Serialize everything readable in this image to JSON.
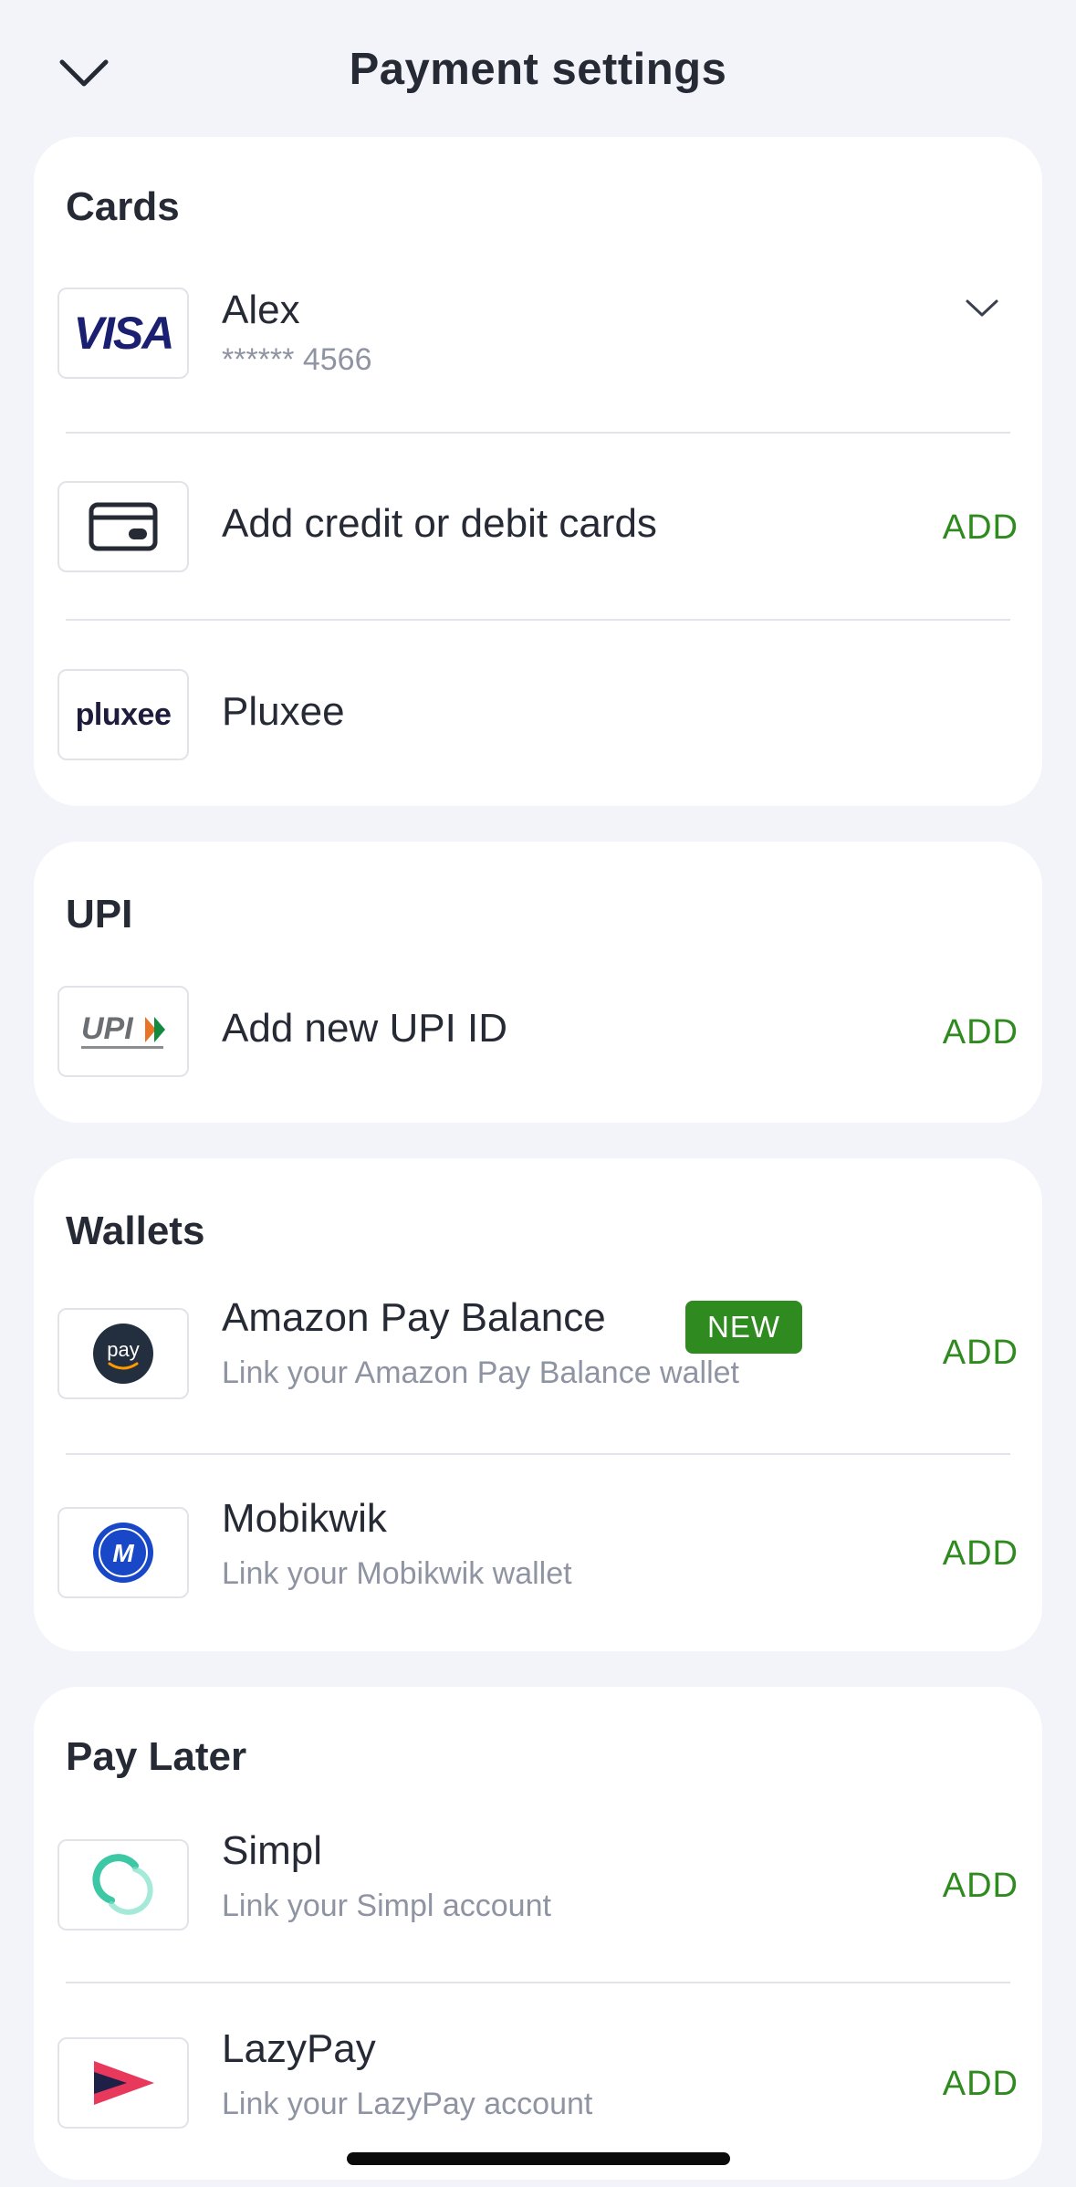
{
  "header": {
    "title": "Payment settings",
    "back_icon": "chevron-down-icon"
  },
  "cards": {
    "title": "Cards",
    "saved_card": {
      "logo": "VISA",
      "name": "Alex",
      "number": "****** 4566"
    },
    "add_card": {
      "label": "Add credit or debit cards",
      "action": "ADD"
    },
    "pluxee": {
      "logo": "pluxee",
      "label": "Pluxee"
    }
  },
  "upi": {
    "title": "UPI",
    "add_upi": {
      "label": "Add new UPI ID",
      "action": "ADD"
    }
  },
  "wallets": {
    "title": "Wallets",
    "items": [
      {
        "name": "Amazon Pay Balance",
        "badge": "NEW",
        "subtitle": "Link your Amazon Pay Balance wallet",
        "action": "ADD",
        "logo": "pay"
      },
      {
        "name": "Mobikwik",
        "subtitle": "Link your Mobikwik wallet",
        "action": "ADD"
      }
    ]
  },
  "pay_later": {
    "title": "Pay Later",
    "items": [
      {
        "name": "Simpl",
        "subtitle": "Link your Simpl account",
        "action": "ADD"
      },
      {
        "name": "LazyPay",
        "subtitle": "Link your LazyPay account",
        "action": "ADD"
      }
    ]
  },
  "colors": {
    "accent_green": "#2f8a1f",
    "background": "#f3f4f9",
    "visa_blue": "#1a1f71"
  }
}
